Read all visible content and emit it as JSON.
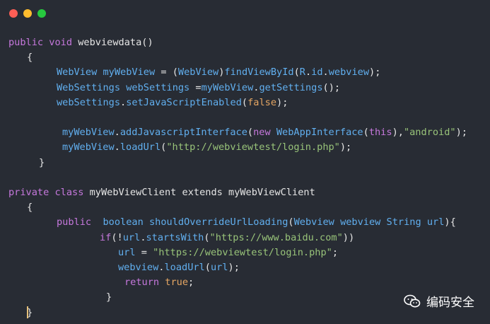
{
  "window": {
    "controls": [
      {
        "name": "close",
        "color": "#ff5f56"
      },
      {
        "name": "minimize",
        "color": "#ffbd2e"
      },
      {
        "name": "maximize",
        "color": "#27c93f"
      }
    ]
  },
  "code": {
    "lines": [
      {
        "indent": 12,
        "tokens": [
          [
            "kw",
            "public"
          ],
          [
            "plain",
            " "
          ],
          [
            "kw",
            "void"
          ],
          [
            "plain",
            " webviewdata()"
          ]
        ]
      },
      {
        "indent": 38,
        "tokens": [
          [
            "plain",
            "{"
          ]
        ]
      },
      {
        "indent": 80,
        "tokens": [
          [
            "blue",
            "WebView"
          ],
          [
            "plain",
            " "
          ],
          [
            "blue",
            "myWebView"
          ],
          [
            "plain",
            " = ("
          ],
          [
            "blue",
            "WebView"
          ],
          [
            "plain",
            ")"
          ],
          [
            "blue",
            "findViewById"
          ],
          [
            "plain",
            "("
          ],
          [
            "blue",
            "R"
          ],
          [
            "plain",
            "."
          ],
          [
            "blue",
            "id"
          ],
          [
            "plain",
            "."
          ],
          [
            "blue",
            "webview"
          ],
          [
            "plain",
            ");"
          ]
        ]
      },
      {
        "indent": 80,
        "tokens": [
          [
            "blue",
            "WebSettings"
          ],
          [
            "plain",
            " "
          ],
          [
            "blue",
            "webSettings"
          ],
          [
            "plain",
            " ="
          ],
          [
            "blue",
            "myWebView"
          ],
          [
            "plain",
            "."
          ],
          [
            "blue",
            "getSettings"
          ],
          [
            "plain",
            "();"
          ]
        ]
      },
      {
        "indent": 80,
        "tokens": [
          [
            "blue",
            "webSettings"
          ],
          [
            "plain",
            "."
          ],
          [
            "blue",
            "setJavaScriptEnabled"
          ],
          [
            "plain",
            "("
          ],
          [
            "bool",
            "false"
          ],
          [
            "plain",
            ");"
          ]
        ]
      },
      {
        "indent": 0,
        "tokens": []
      },
      {
        "indent": 88,
        "tokens": [
          [
            "blue",
            "myWebView"
          ],
          [
            "plain",
            "."
          ],
          [
            "blue",
            "addJavascriptInterface"
          ],
          [
            "plain",
            "("
          ],
          [
            "kw",
            "new"
          ],
          [
            "plain",
            " "
          ],
          [
            "blue",
            "WebAppInterface"
          ],
          [
            "plain",
            "("
          ],
          [
            "kw",
            "this"
          ],
          [
            "plain",
            "),"
          ],
          [
            "str",
            "\"android\""
          ],
          [
            "plain",
            ");"
          ]
        ]
      },
      {
        "indent": 88,
        "tokens": [
          [
            "blue",
            "myWebView"
          ],
          [
            "plain",
            "."
          ],
          [
            "blue",
            "loadUrl"
          ],
          [
            "plain",
            "("
          ],
          [
            "str",
            "\"http://webviewtest/login.php\""
          ],
          [
            "plain",
            ");"
          ]
        ]
      },
      {
        "indent": 55,
        "tokens": [
          [
            "plain",
            "}"
          ]
        ]
      },
      {
        "indent": 0,
        "tokens": []
      },
      {
        "indent": 12,
        "tokens": [
          [
            "kw",
            "private"
          ],
          [
            "plain",
            " "
          ],
          [
            "kw",
            "class"
          ],
          [
            "plain",
            " myWebViewClient extends myWebViewClient"
          ]
        ]
      },
      {
        "indent": 38,
        "tokens": [
          [
            "plain",
            "{"
          ]
        ]
      },
      {
        "indent": 80,
        "tokens": [
          [
            "kw",
            "public"
          ],
          [
            "plain",
            "  "
          ],
          [
            "blue",
            "boolean"
          ],
          [
            "plain",
            " "
          ],
          [
            "blue",
            "shouldOverrideUrlLoading"
          ],
          [
            "plain",
            "("
          ],
          [
            "blue",
            "Webview"
          ],
          [
            "plain",
            " "
          ],
          [
            "blue",
            "webview"
          ],
          [
            "plain",
            " "
          ],
          [
            "blue",
            "String"
          ],
          [
            "plain",
            " "
          ],
          [
            "blue",
            "url"
          ],
          [
            "plain",
            "){"
          ]
        ]
      },
      {
        "indent": 141,
        "tokens": [
          [
            "kw",
            "if"
          ],
          [
            "plain",
            "(!"
          ],
          [
            "blue",
            "url"
          ],
          [
            "plain",
            "."
          ],
          [
            "blue",
            "startsWith"
          ],
          [
            "plain",
            "("
          ],
          [
            "str",
            "\"https://www.baidu.com\""
          ],
          [
            "plain",
            "))"
          ]
        ]
      },
      {
        "indent": 167,
        "tokens": [
          [
            "blue",
            "url"
          ],
          [
            "plain",
            " = "
          ],
          [
            "str",
            "\"https://webviewtest/login.php\""
          ],
          [
            "plain",
            ";"
          ]
        ]
      },
      {
        "indent": 167,
        "tokens": [
          [
            "blue",
            "webview"
          ],
          [
            "plain",
            "."
          ],
          [
            "blue",
            "loadUrl"
          ],
          [
            "plain",
            "("
          ],
          [
            "blue",
            "url"
          ],
          [
            "plain",
            ");"
          ]
        ]
      },
      {
        "indent": 176,
        "tokens": [
          [
            "kw",
            "return"
          ],
          [
            "plain",
            " "
          ],
          [
            "bool",
            "true"
          ],
          [
            "plain",
            ";"
          ]
        ]
      },
      {
        "indent": 150,
        "tokens": [
          [
            "plain",
            "}"
          ]
        ]
      },
      {
        "indent": 38,
        "tokens": [
          [
            "plain",
            "}"
          ]
        ]
      }
    ]
  },
  "watermark": {
    "icon": "wechat-icon",
    "text": "编码安全"
  }
}
